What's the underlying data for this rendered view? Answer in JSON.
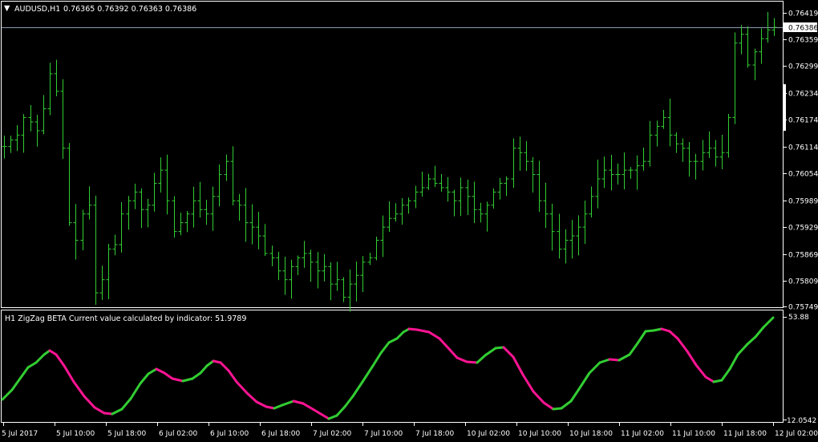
{
  "main_chart": {
    "symbol_label": "AUDUSD,H1",
    "ohlc_text": "0.76365 0.76392 0.76363 0.76386",
    "current_price_label": "0.76386",
    "price_ticks": [
      "0.76419",
      "0.76359",
      "0.76299",
      "0.76234",
      "0.76174",
      "0.76114",
      "0.76054",
      "0.75989",
      "0.75929",
      "0.75869",
      "0.75809",
      "0.75749"
    ]
  },
  "indicator_panel": {
    "title": "H1 ZigZag BETA Current value calculated by indicator: 51.9789",
    "max_label": "53.88",
    "min_label": "12.0542"
  },
  "time_axis": {
    "labels": [
      "5 Jul 2017",
      "5 Jul 10:00",
      "5 Jul 18:00",
      "6 Jul 02:00",
      "6 Jul 10:00",
      "6 Jul 18:00",
      "7 Jul 02:00",
      "7 Jul 10:00",
      "7 Jul 18:00",
      "10 Jul 02:00",
      "10 Jul 10:00",
      "10 Jul 18:00",
      "11 Jul 02:00",
      "11 Jul 10:00",
      "11 Jul 18:00",
      "12 Jul 02:00"
    ]
  },
  "colors": {
    "background": "#000000",
    "bar": "#32cd32",
    "indicator_up": "#32cd32",
    "indicator_down": "#ff1493",
    "grid_line": "#ffffff",
    "current_price_line": "#8a9bb0"
  },
  "chart_data": {
    "type": "line",
    "title": "AUDUSD,H1",
    "ylim": [
      0.75749,
      0.76419
    ],
    "price_closes_approx": [
      0.76114,
      0.76129,
      0.7614,
      0.7618,
      0.7617,
      0.7615,
      0.762,
      0.7628,
      0.7624,
      0.7611,
      0.7594,
      0.759,
      0.7596,
      0.7598,
      0.7578,
      0.7581,
      0.7588,
      0.7589,
      0.7596,
      0.7599,
      0.7601,
      0.7597,
      0.7598,
      0.7603,
      0.7606,
      0.7599,
      0.7592,
      0.7594,
      0.7596,
      0.7599,
      0.7597,
      0.7596,
      0.76,
      0.7605,
      0.7608,
      0.7599,
      0.7598,
      0.7594,
      0.7593,
      0.7591,
      0.7587,
      0.7586,
      0.7583,
      0.7581,
      0.7584,
      0.7586,
      0.7587,
      0.7585,
      0.7583,
      0.7584,
      0.758,
      0.7581,
      0.7577,
      0.758,
      0.7582,
      0.7585,
      0.7586,
      0.759,
      0.7593,
      0.7595,
      0.7596,
      0.7598,
      0.7599,
      0.7601,
      0.7602,
      0.7604,
      0.7603,
      0.7602,
      0.7601,
      0.7599,
      0.7602,
      0.76,
      0.7597,
      0.7596,
      0.7598,
      0.7601,
      0.7603,
      0.7604,
      0.7611,
      0.761,
      0.7608,
      0.7605,
      0.7599,
      0.7596,
      0.7592,
      0.7588,
      0.759,
      0.7591,
      0.7593,
      0.7596,
      0.76,
      0.7604,
      0.7606,
      0.7605,
      0.7605,
      0.7606,
      0.7606,
      0.7607,
      0.7608,
      0.7614,
      0.7616,
      0.7618,
      0.7614,
      0.7612,
      0.7611,
      0.7608,
      0.7608,
      0.761,
      0.7611,
      0.7609,
      0.761,
      0.7618,
      0.7635,
      0.7637,
      0.763,
      0.7633,
      0.7636,
      0.7638,
      0.76386
    ]
  }
}
